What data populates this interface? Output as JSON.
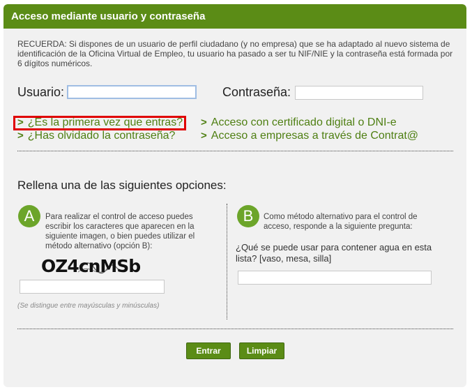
{
  "header": {
    "title": "Acceso mediante usuario y contraseña"
  },
  "notice": {
    "text": "RECUERDA: Si dispones de un usuario de perfil ciudadano (y no empresa) que se ha adaptado al nuevo sistema de identificación de la Oficina Virtual de Empleo, tu usuario ha pasado a ser tu NIF/NIE y la contraseña está formada por 6 dígitos numéricos."
  },
  "login": {
    "user_label": "Usuario:",
    "user_value": "",
    "password_label": "Contraseña:",
    "password_value": ""
  },
  "links": {
    "first_time": "¿Es la primera vez que entras?",
    "forgot": "¿Has olvidado la contraseña?",
    "certificate": "Acceso con certificado digital o DNI-e",
    "companies": "Acceso a empresas a través de Contrat@"
  },
  "options": {
    "title": "Rellena una de las siguientes opciones:",
    "a": {
      "letter": "A",
      "description": "Para realizar el control de acceso puedes escribir los caracteres que aparecen en la siguiente imagen, o bien puedes utilizar el método alternativo (opción B):",
      "captcha_text": "OZ4cnMSb",
      "input_value": "",
      "hint": "(Se distingue entre mayúsculas y minúsculas)"
    },
    "b": {
      "letter": "B",
      "description": "Como método alternativo para el control de acceso, responde a la siguiente pregunta:",
      "question": "¿Qué se puede usar para contener agua en esta lista? [vaso, mesa, silla]",
      "input_value": ""
    }
  },
  "buttons": {
    "submit": "Entrar",
    "clear": "Limpiar"
  },
  "colors": {
    "header_green": "#5b8c16",
    "link_green": "#4e7f12",
    "highlight_red": "#e00000"
  }
}
